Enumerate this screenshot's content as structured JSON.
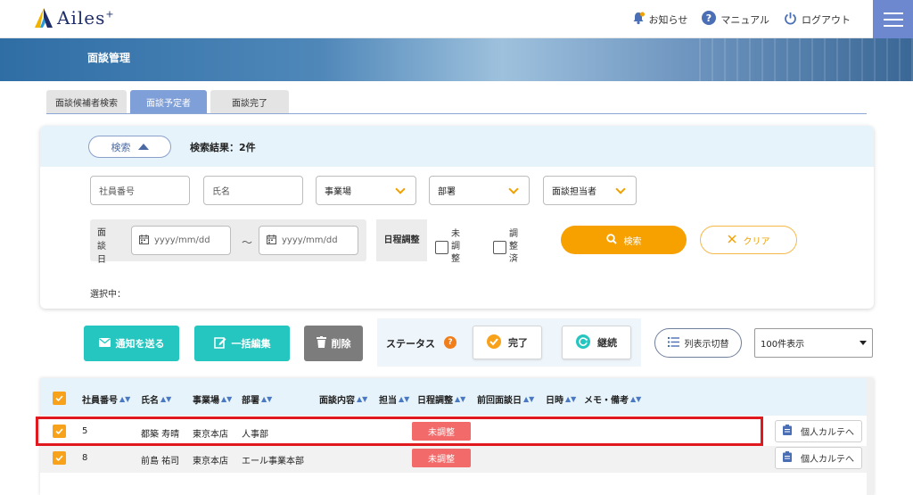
{
  "header": {
    "logo_text": "Ailes",
    "logo_sup": "+",
    "notice_label": "お知らせ",
    "manual_label": "マニュアル",
    "logout_label": "ログアウト"
  },
  "banner": {
    "title": "面談管理"
  },
  "tabs": [
    {
      "label": "面談候補者検索",
      "active": false
    },
    {
      "label": "面談予定者",
      "active": true
    },
    {
      "label": "面談完了",
      "active": false
    }
  ],
  "search": {
    "toggle_label": "検索",
    "result_count": "検索結果：2件",
    "employee_no_placeholder": "社員番号",
    "name_placeholder": "氏名",
    "office_label": "事業場",
    "dept_label": "部署",
    "interviewer_label": "面談担当者",
    "date_label": "面談日",
    "date_from_placeholder": "yyyy/mm/dd",
    "date_to_placeholder": "yyyy/mm/dd",
    "tilde": "～",
    "schedule_label": "日程調整",
    "unadjusted_label": "未調整",
    "adjusted_label": "調整済",
    "search_button": "検索",
    "clear_button": "クリア",
    "selected_label": "選択中："
  },
  "actions": {
    "notify_button": "通知を送る",
    "bulk_edit_button": "一括編集",
    "delete_button": "削除",
    "status_label": "ステータス",
    "complete_button": "完了",
    "continue_button": "継続",
    "column_toggle": "列表示切替",
    "per_page": "100件表示"
  },
  "table": {
    "headers": [
      "社員番号",
      "氏名",
      "事業場",
      "部署",
      "面談内容",
      "担当",
      "日程調整",
      "前回面談日",
      "日時",
      "メモ・備考"
    ],
    "rows": [
      {
        "emp_no": "5",
        "name": "都築 寿晴",
        "office": "東京本店",
        "dept": "人事部",
        "schedule": "未調整",
        "action": "個人カルテへ"
      },
      {
        "emp_no": "8",
        "name": "前島 祐司",
        "office": "東京本店",
        "dept": "エール事業本部",
        "schedule": "未調整",
        "action": "個人カルテへ"
      }
    ]
  },
  "colors": {
    "accent": "#7f9fd8",
    "orange": "#f7a100",
    "teal": "#26c6c0",
    "badge_red": "#f26a6a",
    "highlight_red": "#e0191f"
  }
}
